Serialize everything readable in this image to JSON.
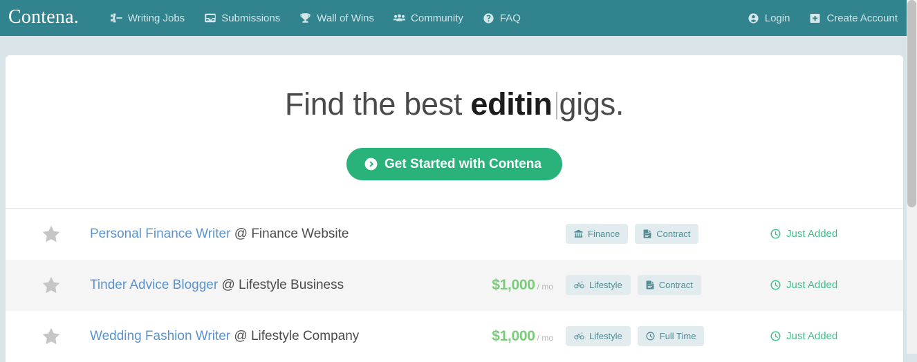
{
  "brand": {
    "name": "Contena."
  },
  "nav": {
    "left_items": [
      {
        "label": "Writing Jobs",
        "icon": "jet-icon"
      },
      {
        "label": "Submissions",
        "icon": "inbox-icon"
      },
      {
        "label": "Wall of Wins",
        "icon": "trophy-icon"
      },
      {
        "label": "Community",
        "icon": "users-icon"
      },
      {
        "label": "FAQ",
        "icon": "question-circle-icon"
      }
    ],
    "right_items": [
      {
        "label": "Login",
        "icon": "user-circle-icon"
      },
      {
        "label": "Create Account",
        "icon": "plus-square-icon"
      }
    ]
  },
  "hero": {
    "headline_prefix": "Find the best",
    "headline_typed": "editin",
    "headline_suffix": "gigs.",
    "cta_label": "Get Started with Contena",
    "cta_icon": "arrow-circle-right-icon"
  },
  "jobs": [
    {
      "starred": false,
      "star_icon": "star-icon",
      "title": "Personal Finance Writer",
      "at": "@",
      "company": "Finance Website",
      "price": "",
      "price_unit": "",
      "tags": [
        {
          "label": "Finance",
          "icon": "bank-icon"
        },
        {
          "label": "Contract",
          "icon": "file-text-icon"
        }
      ],
      "status": "Just Added",
      "status_icon": "clock-icon"
    },
    {
      "starred": false,
      "star_icon": "star-icon",
      "title": "Tinder Advice Blogger",
      "at": "@",
      "company": "Lifestyle Business",
      "price": "$1,000",
      "price_unit": "/ mo",
      "tags": [
        {
          "label": "Lifestyle",
          "icon": "bicycle-icon"
        },
        {
          "label": "Contract",
          "icon": "file-text-icon"
        }
      ],
      "status": "Just Added",
      "status_icon": "clock-icon"
    },
    {
      "starred": false,
      "star_icon": "star-icon",
      "title": "Wedding Fashion Writer",
      "at": "@",
      "company": "Lifestyle Company",
      "price": "$1,000",
      "price_unit": "/ mo",
      "tags": [
        {
          "label": "Lifestyle",
          "icon": "bicycle-icon"
        },
        {
          "label": "Full Time",
          "icon": "clock-icon"
        }
      ],
      "status": "Just Added",
      "status_icon": "clock-icon"
    }
  ],
  "colors": {
    "navbar_background": "#31838e",
    "page_background": "#d8e4e8",
    "cta_green": "#2ab27b",
    "link_blue": "#5b93cd",
    "price_green": "#79cc79",
    "status_green": "#41bd8b",
    "tag_background": "#e2ebed",
    "tag_text": "#4e8e96",
    "row_alt_background": "#f5f5f5"
  }
}
